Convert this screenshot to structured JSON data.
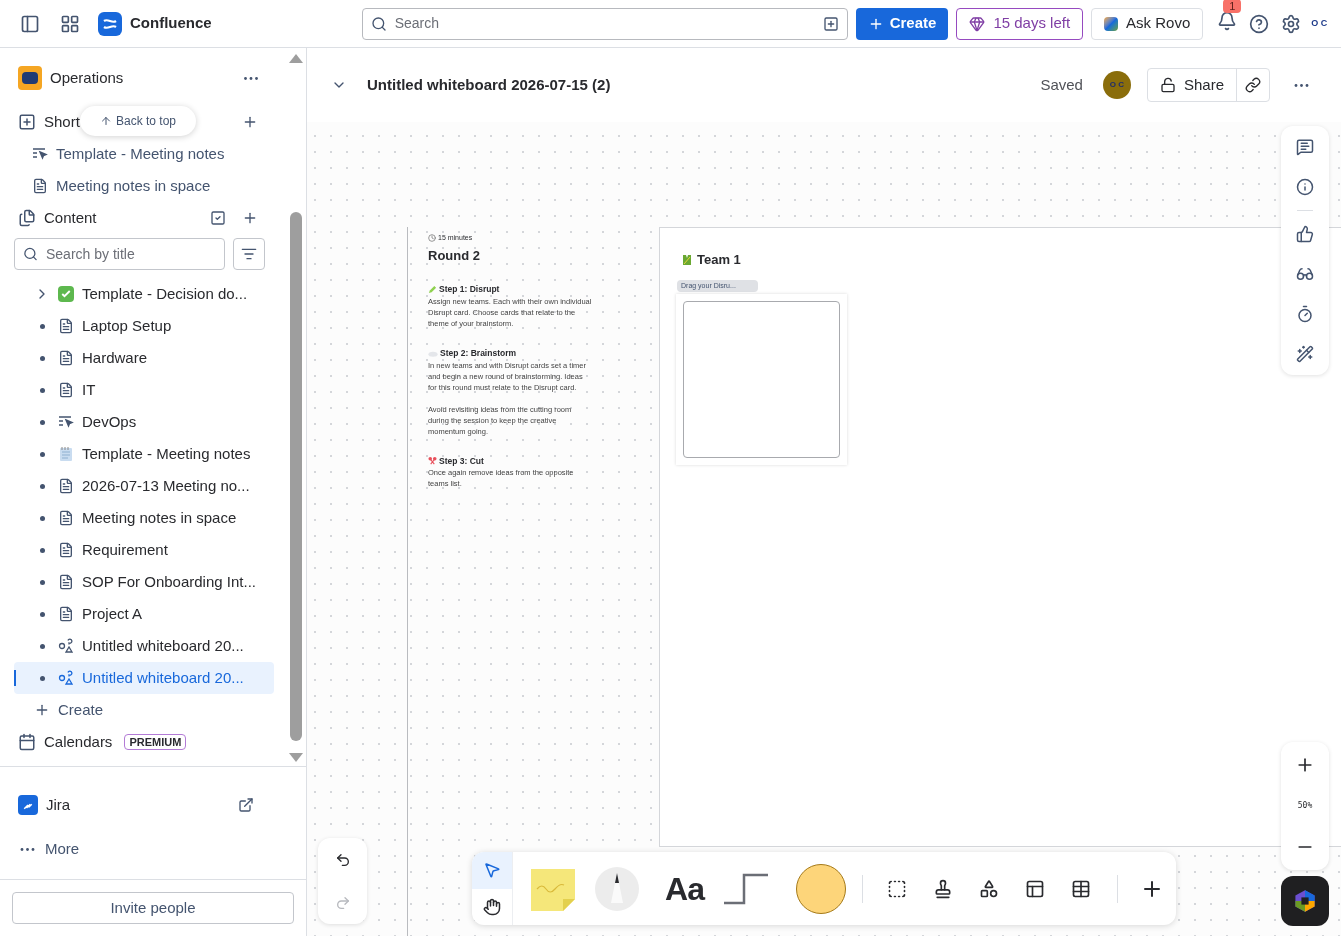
{
  "topbar": {
    "app_name": "Confluence",
    "search": {
      "placeholder": "Search"
    },
    "create": "Create",
    "trial": "15 days left",
    "ask_rovo": "Ask Rovo",
    "notification_count": "1",
    "profile_initials": "O C"
  },
  "sidebar": {
    "space": "Operations",
    "shortcuts_label": "Short",
    "back_to_top": "Back to top",
    "shortcuts": [
      {
        "kind": "live",
        "label": "Template - Meeting notes"
      },
      {
        "kind": "page",
        "label": "Meeting notes in space"
      }
    ],
    "content_label": "Content",
    "search": {
      "placeholder": "Search by title"
    },
    "tree": [
      {
        "kind": "decision",
        "label": "Template - Decision do...",
        "expandable": true,
        "selected": false
      },
      {
        "kind": "page",
        "label": "Laptop Setup",
        "expandable": false,
        "selected": false
      },
      {
        "kind": "page",
        "label": "Hardware",
        "expandable": false,
        "selected": false
      },
      {
        "kind": "page",
        "label": "IT",
        "expandable": false,
        "selected": false
      },
      {
        "kind": "live",
        "label": "DevOps",
        "expandable": false,
        "selected": false
      },
      {
        "kind": "notes",
        "label": "Template - Meeting notes",
        "expandable": false,
        "selected": false
      },
      {
        "kind": "page",
        "label": "2026-07-13 Meeting no...",
        "expandable": false,
        "selected": false
      },
      {
        "kind": "page",
        "label": "Meeting notes in space",
        "expandable": false,
        "selected": false
      },
      {
        "kind": "page",
        "label": "Requirement",
        "expandable": false,
        "selected": false
      },
      {
        "kind": "page",
        "label": "SOP For Onboarding Int...",
        "expandable": false,
        "selected": false
      },
      {
        "kind": "page",
        "label": "Project A",
        "expandable": false,
        "selected": false
      },
      {
        "kind": "whiteboard",
        "label": "Untitled whiteboard 20...",
        "expandable": false,
        "selected": false
      },
      {
        "kind": "whiteboard",
        "label": "Untitled whiteboard 20...",
        "expandable": false,
        "selected": true
      }
    ],
    "create": "Create",
    "calendars": "Calendars",
    "calendars_badge": "PREMIUM",
    "apps": [
      {
        "kind": "jira",
        "label": "Jira"
      },
      {
        "kind": "more",
        "label": "More"
      }
    ],
    "invite": "Invite people"
  },
  "whiteboard": {
    "title": "Untitled whiteboard 2026-07-15 (2)",
    "status": "Saved",
    "avatar_initials": "O C",
    "share": "Share",
    "zoom": "50%",
    "text_tool_label": "Aa",
    "nav_tools": [
      {
        "kind": "select",
        "selected": true
      },
      {
        "kind": "hand",
        "selected": false
      }
    ],
    "round": {
      "duration": "15 minutes",
      "title": "Round 2",
      "steps": [
        {
          "kind": "disrupt",
          "title": "Step 1: Disrupt",
          "paragraphs": [
            "Assign new teams. Each with their own individual Disrupt card. Choose cards that relate to the theme of your brainstorm."
          ]
        },
        {
          "kind": "brainstorm",
          "title": "Step 2: Brainstorm",
          "paragraphs": [
            "In new teams and with Disrupt cards set a timer and begin a new round of brainstorming. Ideas for this round must relate to the Disrupt card.",
            "Avoid revisiting ideas from the cutting room during the session to keep the creative momentum going."
          ]
        },
        {
          "kind": "cut",
          "title": "Step 3: Cut",
          "paragraphs": [
            "Once again remove ideas from the opposite teams list."
          ]
        }
      ]
    },
    "team": {
      "title": "Team 1",
      "tag": "Drag your Disru..."
    }
  }
}
